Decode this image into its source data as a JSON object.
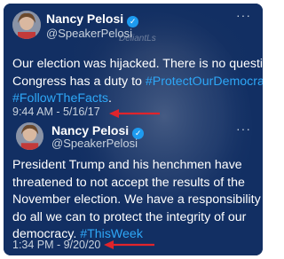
{
  "watermark": "DeliantLs",
  "tweets": [
    {
      "name": "Nancy Pelosi",
      "handle": "@SpeakerPelosi",
      "more": "···",
      "text_lines": [
        "Our election was hijacked. There is no question.",
        "Congress has a duty to "
      ],
      "hashtags": [
        "#ProtectOurDemocracy",
        "#FollowTheFacts"
      ],
      "connector": " & ",
      "trailing": ".",
      "timestamp": "9:44 AM - 5/16/17"
    },
    {
      "name": "Nancy Pelosi",
      "handle": "@SpeakerPelosi",
      "more": "···",
      "text_lines": [
        "President Trump and his henchmen have",
        "threatened to not accept the results of the",
        "November election. We have a responsibility to",
        "do all we can to protect the integrity of our",
        "democracy. "
      ],
      "hashtags": [
        "#ThisWeek"
      ],
      "timestamp": "1:34 PM - 9/20/20"
    }
  ],
  "colors": {
    "background": "#122f63",
    "hashtag": "#2ea7f7",
    "arrow": "#e0242b",
    "verified": "#1d9bf0"
  }
}
